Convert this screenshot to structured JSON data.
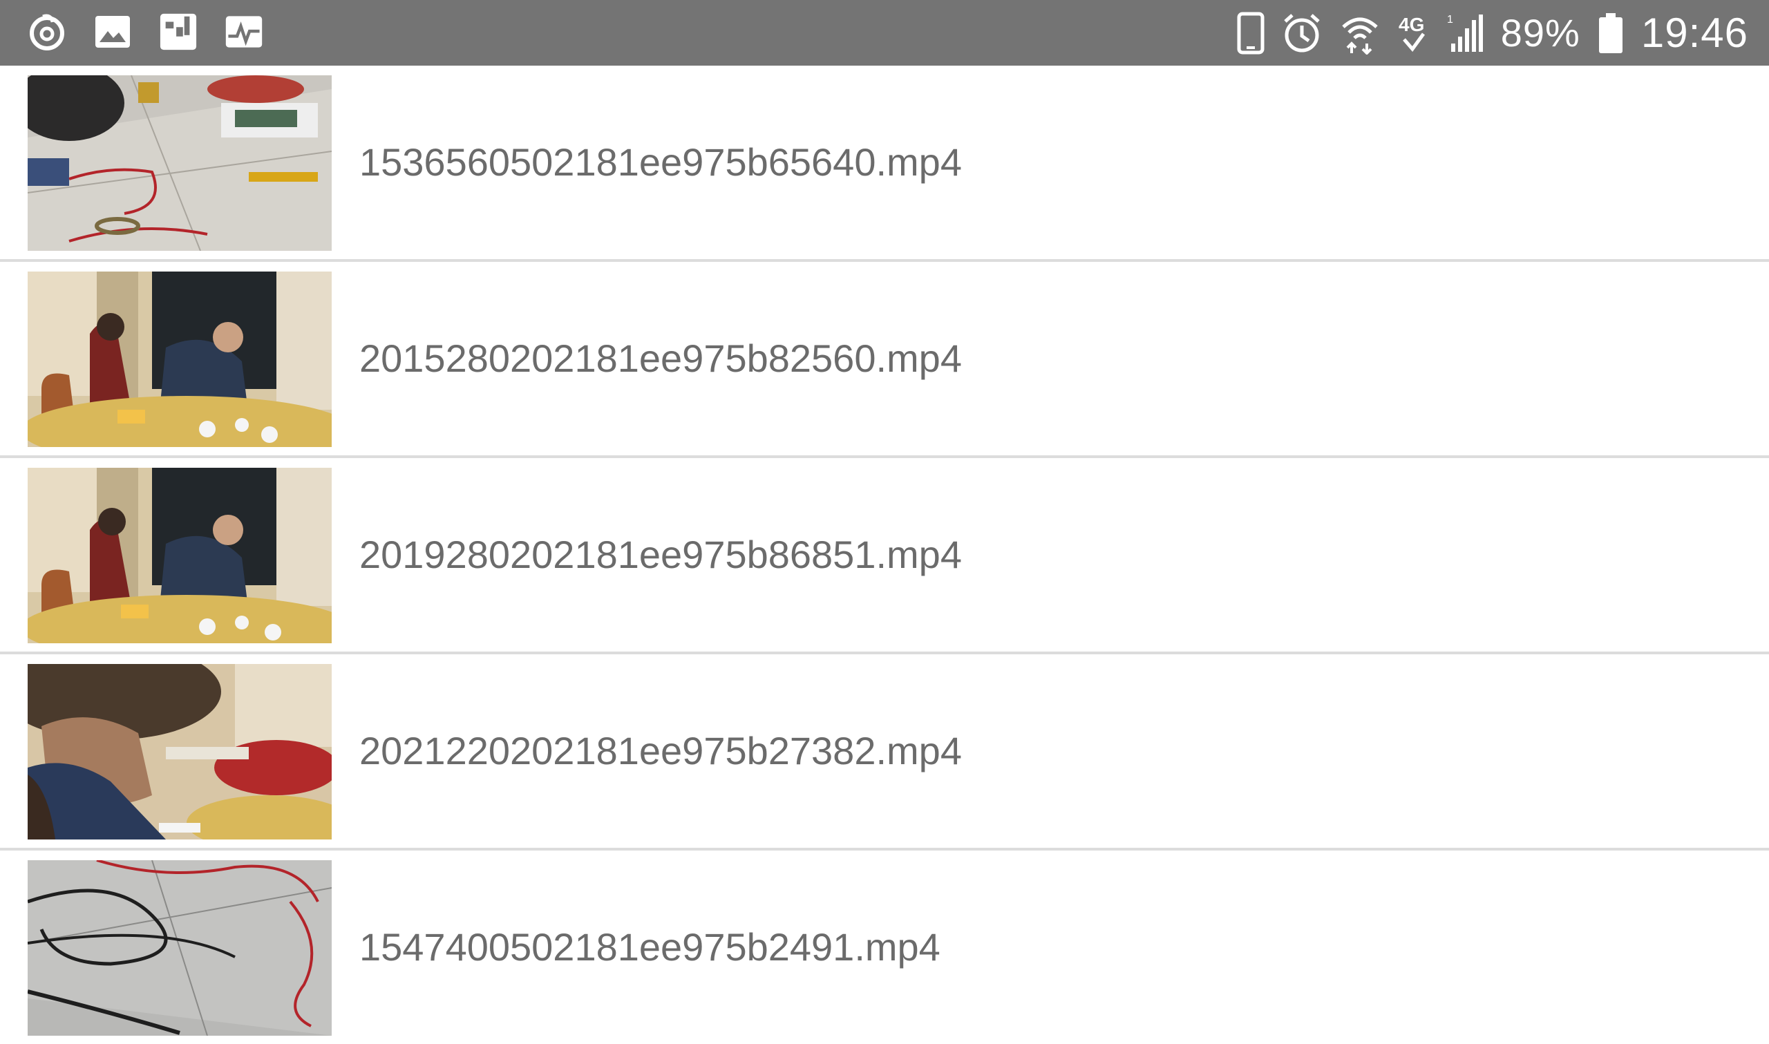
{
  "status_bar": {
    "left_icons": [
      "netease-music-icon",
      "gallery-icon",
      "transfer-icon",
      "activity-monitor-icon"
    ],
    "right_icons": [
      "phone-icon",
      "alarm-icon",
      "wifi-icon",
      "network-4g-icon",
      "signal-icon"
    ],
    "battery_percent": "89%",
    "time": "19:46"
  },
  "files": [
    {
      "name": "153656050218 1ee975b65640.mp4",
      "thumbnail": "workbench-cables"
    },
    {
      "name": "2015280202181ee975b82560.mp4",
      "thumbnail": "dinner-table"
    },
    {
      "name": "2019280202181ee975b86851.mp4",
      "thumbnail": "dinner-table"
    },
    {
      "name": "2021220202181ee975b27382.mp4",
      "thumbnail": "elder-eating"
    },
    {
      "name": "1547400502181ee975b2491.mp4",
      "thumbnail": "floor-cables"
    }
  ],
  "colors": {
    "status_bar_bg": "#747474",
    "file_text": "#6b6b6b",
    "divider": "#dcdcdc"
  }
}
